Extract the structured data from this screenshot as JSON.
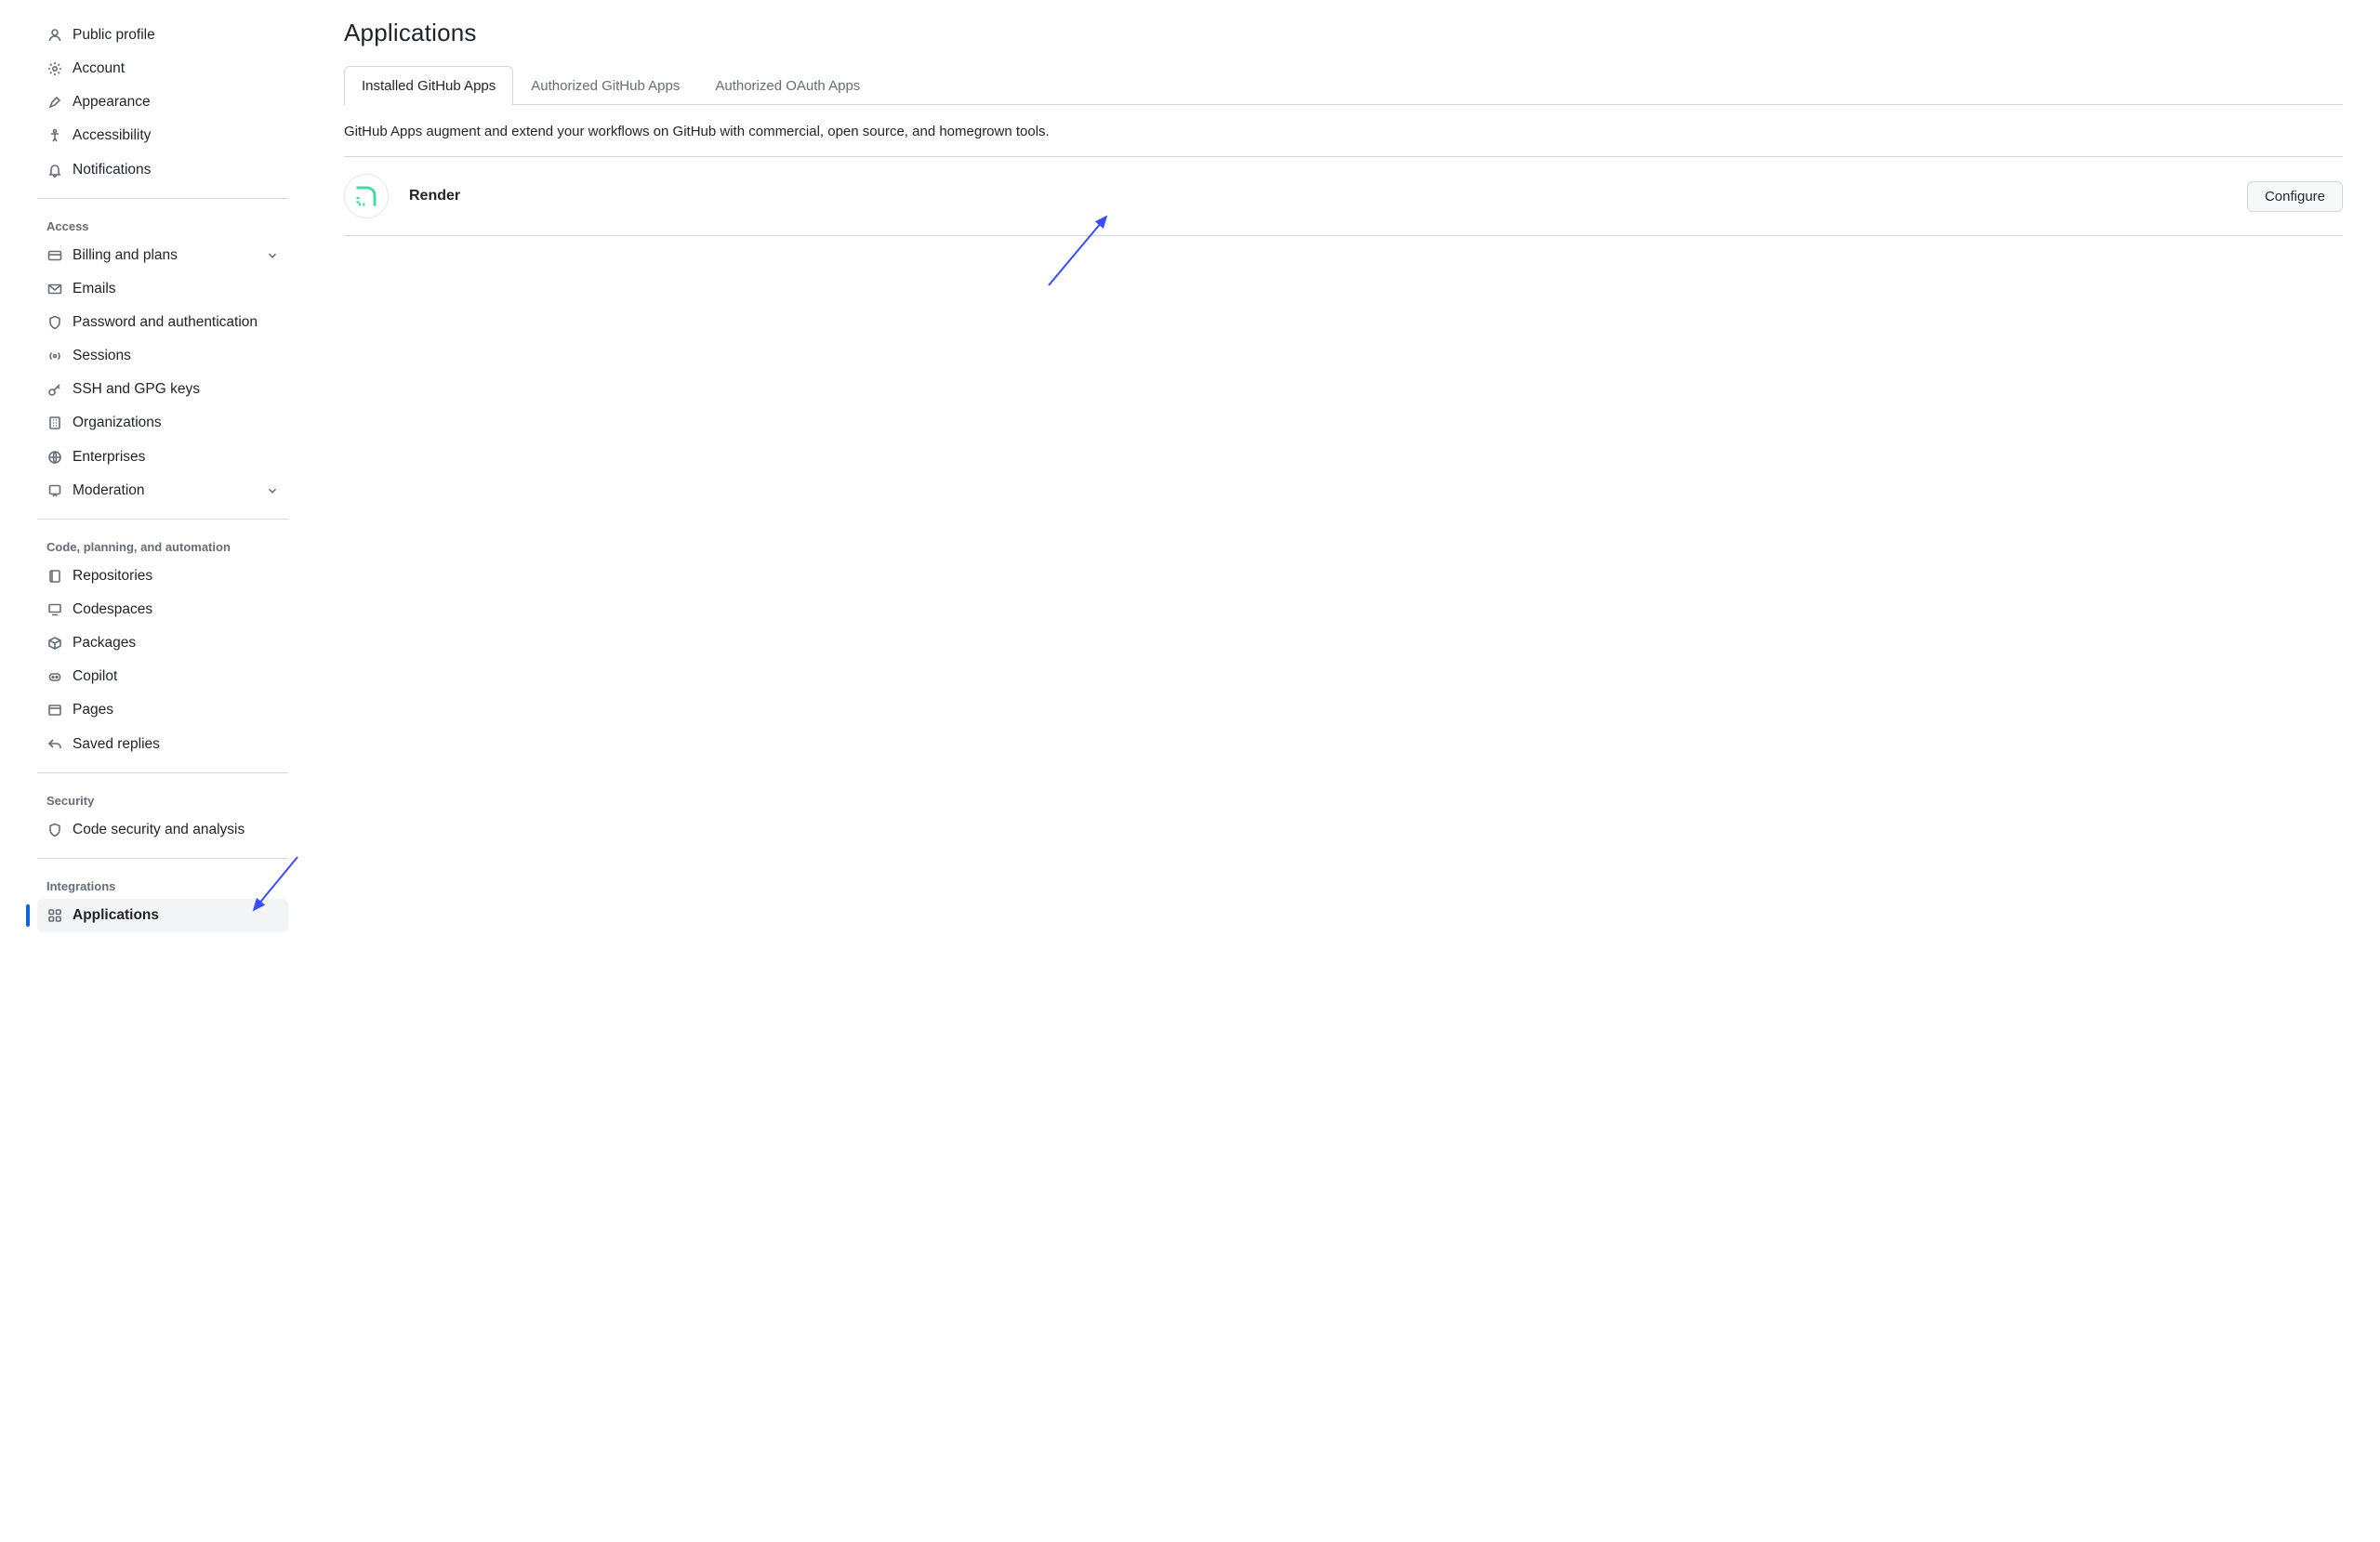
{
  "page_title": "Applications",
  "sidebar": {
    "top_items": [
      {
        "label": "Public profile",
        "icon": "person"
      },
      {
        "label": "Account",
        "icon": "gear"
      },
      {
        "label": "Appearance",
        "icon": "paintbrush"
      },
      {
        "label": "Accessibility",
        "icon": "accessibility"
      },
      {
        "label": "Notifications",
        "icon": "bell"
      }
    ],
    "sections": [
      {
        "label": "Access",
        "items": [
          {
            "label": "Billing and plans",
            "icon": "credit-card",
            "expandable": true
          },
          {
            "label": "Emails",
            "icon": "mail"
          },
          {
            "label": "Password and authentication",
            "icon": "shield-lock"
          },
          {
            "label": "Sessions",
            "icon": "broadcast"
          },
          {
            "label": "SSH and GPG keys",
            "icon": "key"
          },
          {
            "label": "Organizations",
            "icon": "organization"
          },
          {
            "label": "Enterprises",
            "icon": "globe"
          },
          {
            "label": "Moderation",
            "icon": "report",
            "expandable": true
          }
        ]
      },
      {
        "label": "Code, planning, and automation",
        "items": [
          {
            "label": "Repositories",
            "icon": "repo"
          },
          {
            "label": "Codespaces",
            "icon": "codespaces"
          },
          {
            "label": "Packages",
            "icon": "package"
          },
          {
            "label": "Copilot",
            "icon": "copilot"
          },
          {
            "label": "Pages",
            "icon": "browser"
          },
          {
            "label": "Saved replies",
            "icon": "reply"
          }
        ]
      },
      {
        "label": "Security",
        "items": [
          {
            "label": "Code security and analysis",
            "icon": "shield-lock"
          }
        ]
      },
      {
        "label": "Integrations",
        "items": [
          {
            "label": "Applications",
            "icon": "apps",
            "active": true
          }
        ]
      }
    ]
  },
  "tabs": [
    {
      "label": "Installed GitHub Apps",
      "active": true
    },
    {
      "label": "Authorized GitHub Apps",
      "active": false
    },
    {
      "label": "Authorized OAuth Apps",
      "active": false
    }
  ],
  "description": "GitHub Apps augment and extend your workflows on GitHub with commercial, open source, and homegrown tools.",
  "apps": [
    {
      "name": "Render",
      "configure_label": "Configure"
    }
  ],
  "annotations": {
    "arrow_color": "#3b4cff"
  }
}
